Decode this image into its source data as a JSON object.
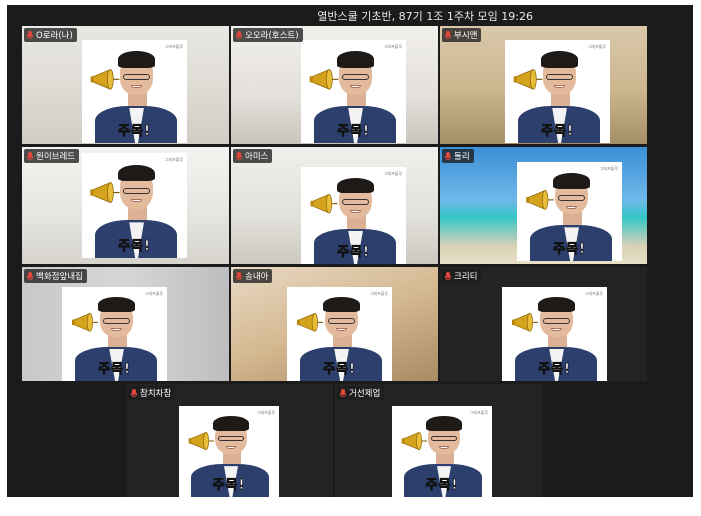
{
  "meeting_title": "열반스쿨 기초반, 87기 1조 1주차 모임 19:26",
  "portrait_logo": "그래프블루",
  "portrait_caption": "주목!",
  "participants": [
    {
      "name": "O로라(나)",
      "background": "white living room",
      "active": false
    },
    {
      "name": "오오라(호스트)",
      "background": "white apartment hall",
      "active": false
    },
    {
      "name": "부시맨",
      "background": "beige boho room",
      "active": false
    },
    {
      "name": "원이브레드",
      "background": "bright modern living room",
      "active": true
    },
    {
      "name": "아미스",
      "background": "white living room with shelf",
      "active": false
    },
    {
      "name": "둘리",
      "background": "tropical sea",
      "active": false
    },
    {
      "name": "백화점앞내집",
      "background": "grey wall",
      "active": false
    },
    {
      "name": "송내아",
      "background": "warm room",
      "active": false
    },
    {
      "name": "크리티",
      "background": "dark grey",
      "active": false
    },
    {
      "name": "참치차참",
      "background": "dark grey",
      "active": false
    },
    {
      "name": "거선제업",
      "background": "dark grey",
      "active": false
    }
  ],
  "colors": {
    "window_bg": "#1b1b1b",
    "active_border": "#2fd35c",
    "mic_muted": "#e0473a",
    "suit": "#2c3f6d"
  }
}
